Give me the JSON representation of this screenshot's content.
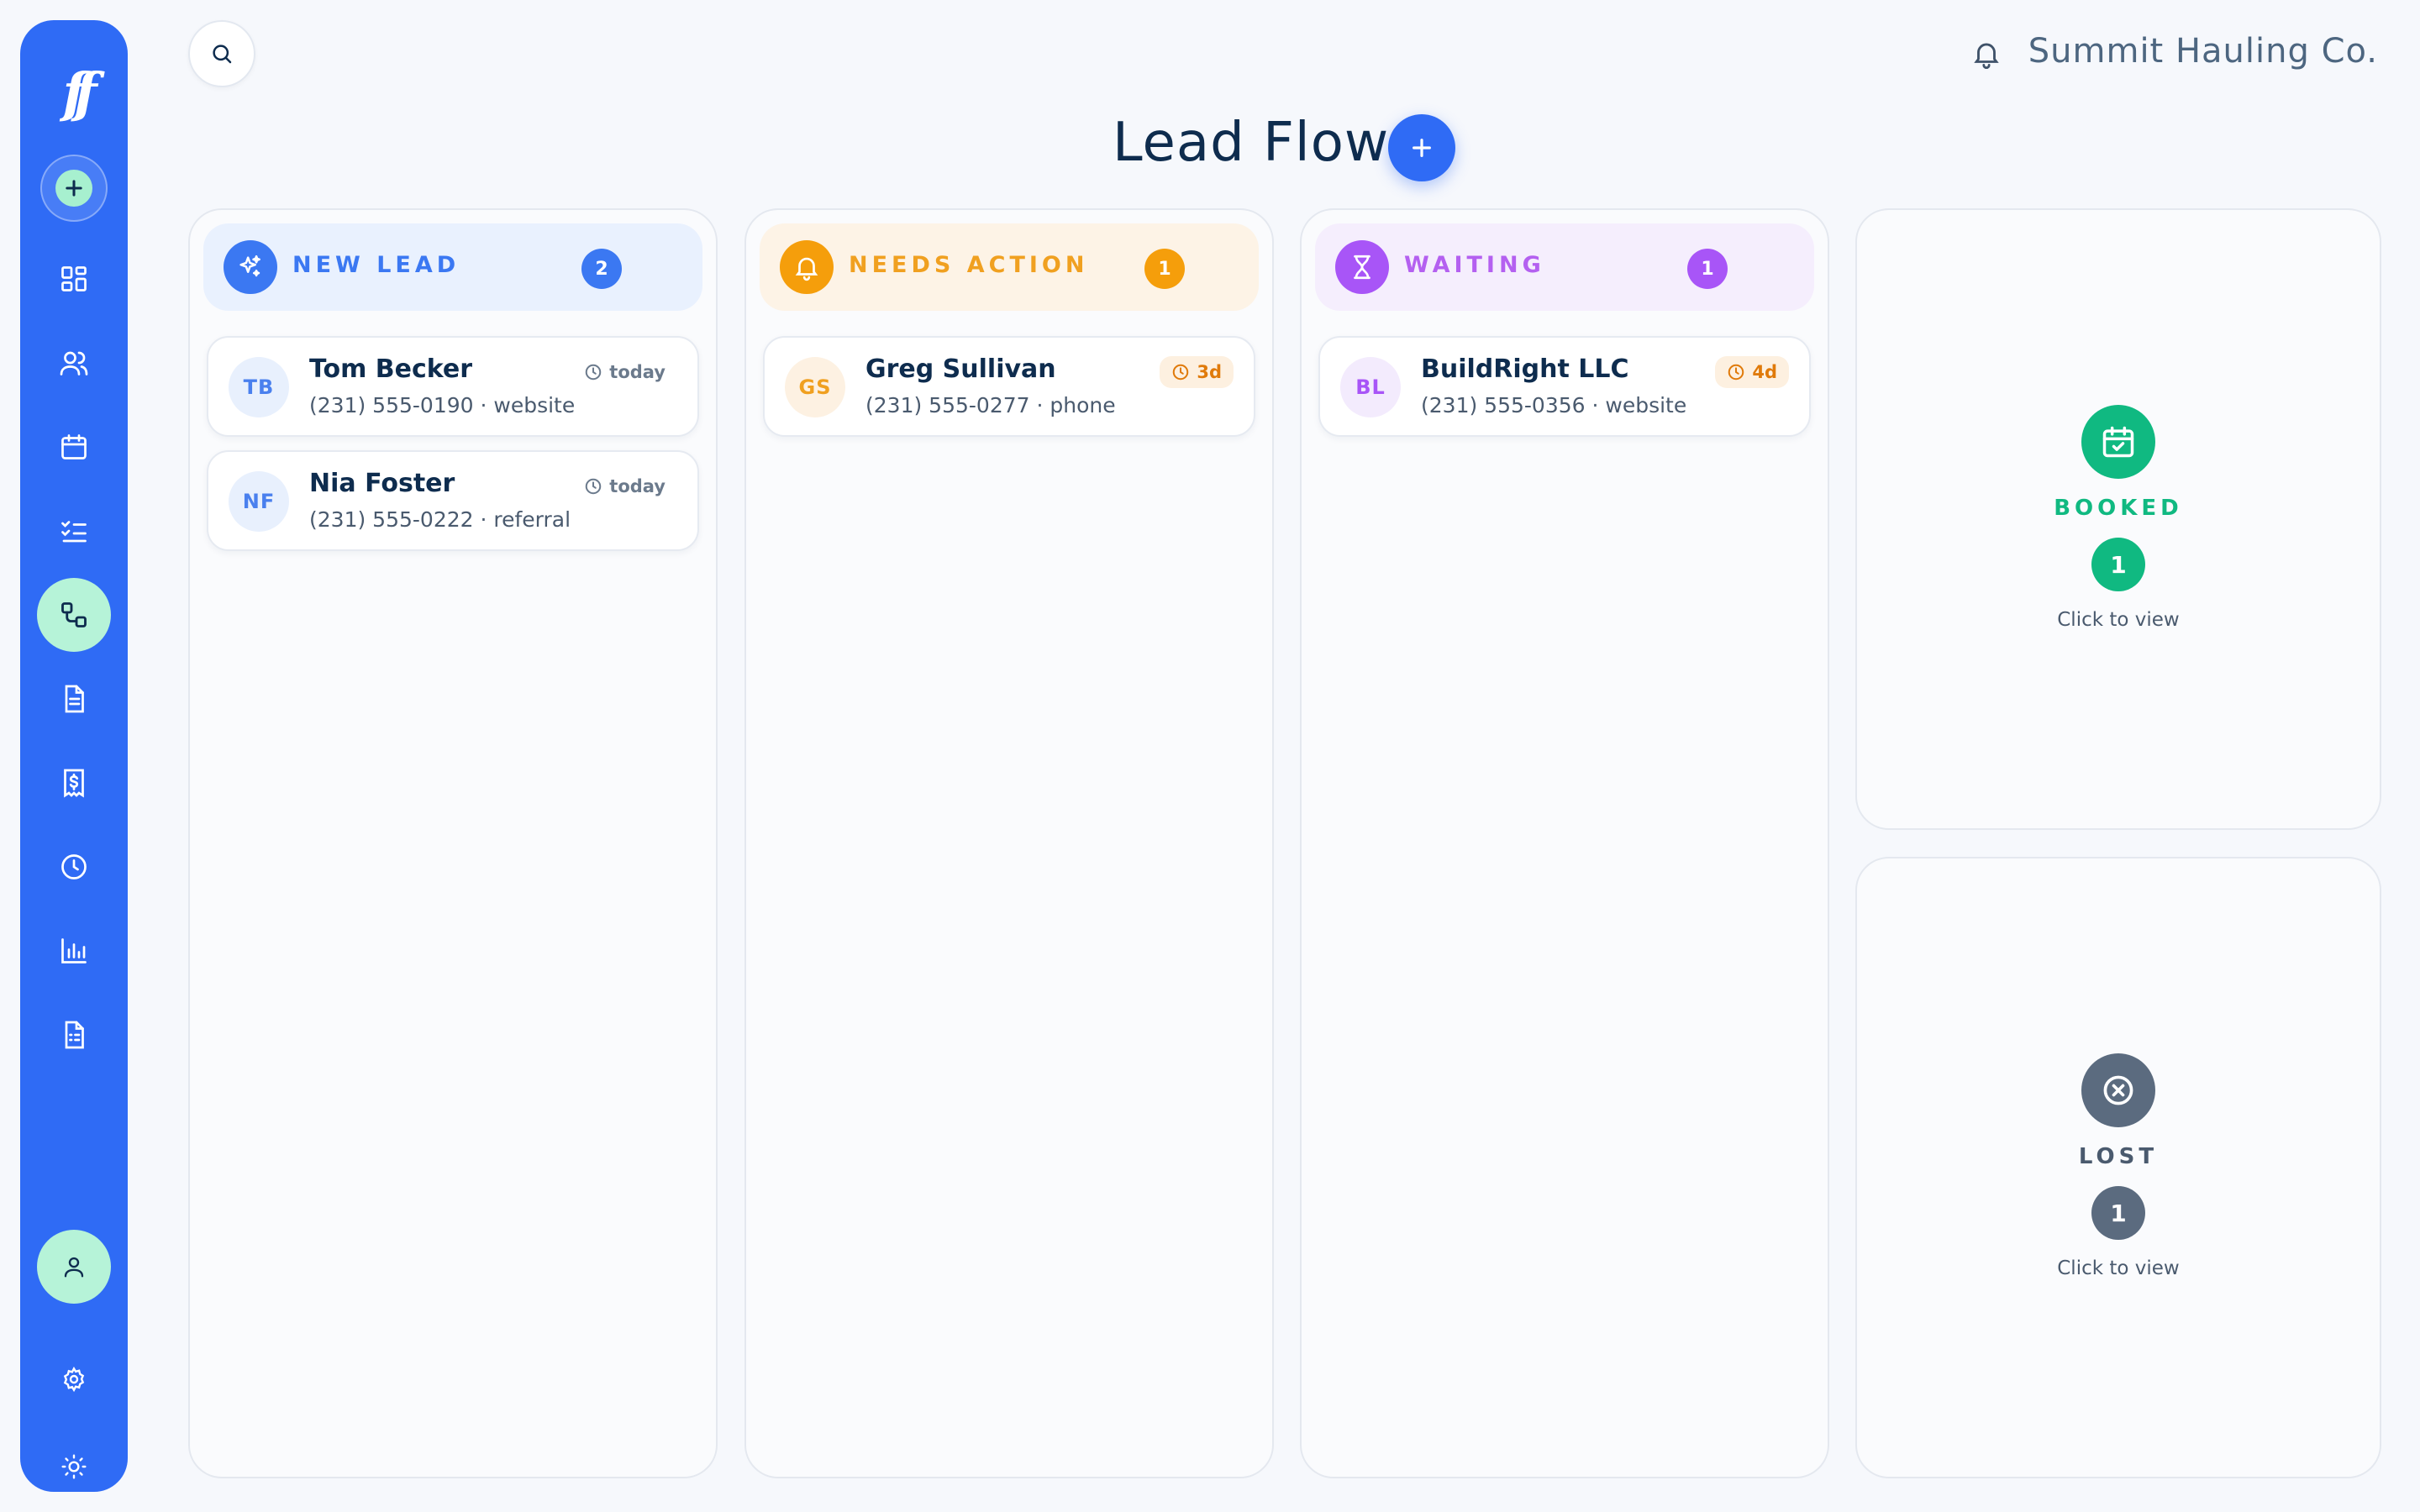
{
  "app": {
    "logo_text": "ff",
    "company": "Summit Hauling Co.",
    "page_title": "Lead Flow"
  },
  "sidebar": {
    "items": [
      {
        "name": "dashboard-icon"
      },
      {
        "name": "users-icon"
      },
      {
        "name": "calendar-icon"
      },
      {
        "name": "checklist-icon"
      },
      {
        "name": "workflow-icon",
        "active": true
      },
      {
        "name": "document-icon"
      },
      {
        "name": "invoice-icon"
      },
      {
        "name": "clock-icon"
      },
      {
        "name": "bar-chart-icon"
      },
      {
        "name": "form-icon"
      }
    ],
    "bottom": [
      {
        "name": "user-icon",
        "active": true
      },
      {
        "name": "settings-icon"
      },
      {
        "name": "sun-icon"
      }
    ]
  },
  "colors": {
    "sidebar": "#2f6bf5",
    "new_lead": "#3b78f2",
    "needs_action": "#f59e0b",
    "waiting": "#a855f7",
    "booked": "#10b981",
    "lost": "#5b6b7f"
  },
  "columns": [
    {
      "label": "NEW LEAD",
      "count": "2",
      "icon": "sparkles-icon",
      "cards": [
        {
          "initials": "TB",
          "name": "Tom Becker",
          "sub": "(231) 555-0190 · website",
          "age": "today"
        },
        {
          "initials": "NF",
          "name": "Nia Foster",
          "sub": "(231) 555-0222 · referral",
          "age": "today"
        }
      ]
    },
    {
      "label": "NEEDS ACTION",
      "count": "1",
      "icon": "bell-icon",
      "cards": [
        {
          "initials": "GS",
          "name": "Greg Sullivan",
          "sub": "(231) 555-0277 · phone",
          "age": "3d"
        }
      ]
    },
    {
      "label": "WAITING",
      "count": "1",
      "icon": "hourglass-icon",
      "cards": [
        {
          "initials": "BL",
          "name": "BuildRight LLC",
          "sub": "(231) 555-0356 · website",
          "age": "4d"
        }
      ]
    }
  ],
  "summary": [
    {
      "label": "BOOKED",
      "count": "1",
      "link": "Click to view",
      "icon": "calendar-check-icon"
    },
    {
      "label": "LOST",
      "count": "1",
      "link": "Click to view",
      "icon": "x-circle-icon"
    }
  ]
}
